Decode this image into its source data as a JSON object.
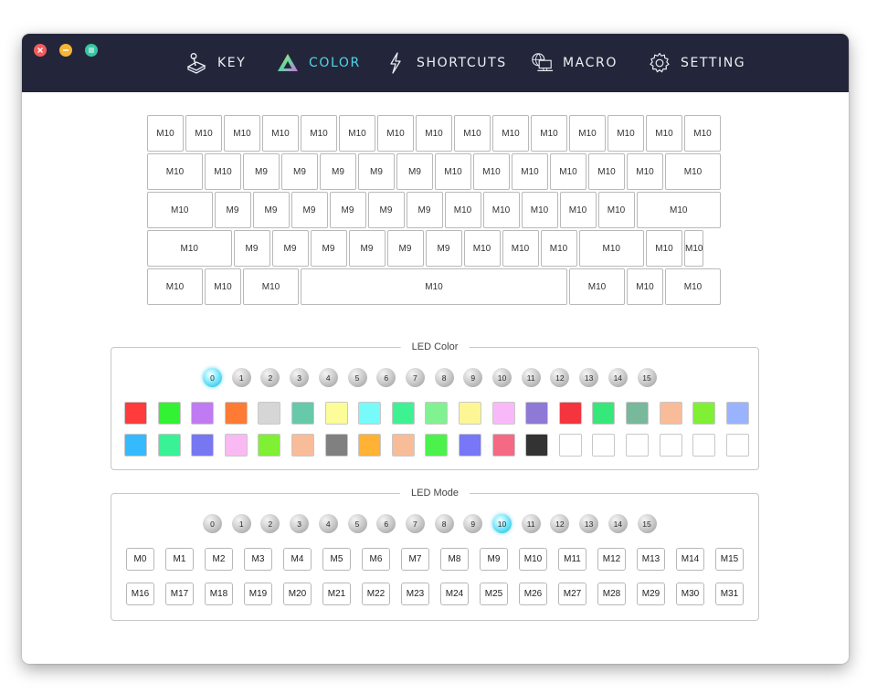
{
  "nav": [
    {
      "label": "KEY",
      "icon": "joystick-icon"
    },
    {
      "label": "COLOR",
      "icon": "triangle-gradient-icon",
      "active": true
    },
    {
      "label": "SHORTCUTS",
      "icon": "lightning-icon"
    },
    {
      "label": "MACRO",
      "icon": "computer-globe-icon"
    },
    {
      "label": "SETTING",
      "icon": "gear-icon"
    }
  ],
  "keyboard": {
    "rows": [
      [
        "M10",
        "M10",
        "M10",
        "M10",
        "M10",
        "M10",
        "M10",
        "M10",
        "M10",
        "M10",
        "M10",
        "M10",
        "M10",
        "M10",
        "M10"
      ],
      [
        "M10",
        "M10",
        "M9",
        "M9",
        "M9",
        "M9",
        "M9",
        "M10",
        "M10",
        "M10",
        "M10",
        "M10",
        "M10",
        "M10"
      ],
      [
        "M10",
        "M9",
        "M9",
        "M9",
        "M9",
        "M9",
        "M9",
        "M10",
        "M10",
        "M10",
        "M10",
        "M10",
        "M10"
      ],
      [
        "M10",
        "M9",
        "M9",
        "M9",
        "M9",
        "M9",
        "M9",
        "M10",
        "M10",
        "M10",
        "M10",
        "M10",
        "M10"
      ],
      [
        "M10",
        "M10",
        "M10",
        "M10",
        "M10",
        "M10",
        "M10"
      ]
    ]
  },
  "led_color": {
    "title": "LED Color",
    "selected_index": 0,
    "indices": [
      "0",
      "1",
      "2",
      "3",
      "4",
      "5",
      "6",
      "7",
      "8",
      "9",
      "10",
      "11",
      "12",
      "13",
      "14",
      "15"
    ],
    "swatch_rows": [
      [
        "#ff3b3b",
        "#33f233",
        "#c07bf2",
        "#ff7a33",
        "#d6d6d6",
        "#66c9a9",
        "#fcfc99",
        "#77fafa",
        "#3ff291",
        "#80f291",
        "#fcf794",
        "#f9b9f9",
        "#8f79d6",
        "#f4353d",
        "#36e87a",
        "#77b99a",
        "#f9bc99",
        "#7ff033",
        "#99b3ff"
      ],
      [
        "#36baff",
        "#38f295",
        "#7777f2",
        "#f9b9f2",
        "#7ff033",
        "#f9bc99",
        "#808080",
        "#ffb233",
        "#f9bc99",
        "#4cf24c",
        "#7777f7",
        "#f56985",
        "#333333",
        "#ffffff",
        "#ffffff",
        "#ffffff",
        "#ffffff",
        "#ffffff",
        "#ffffff"
      ]
    ]
  },
  "led_mode": {
    "title": "LED Mode",
    "selected_index": 10,
    "indices": [
      "0",
      "1",
      "2",
      "3",
      "4",
      "5",
      "6",
      "7",
      "8",
      "9",
      "10",
      "11",
      "12",
      "13",
      "14",
      "15"
    ],
    "mode_rows": [
      [
        "M0",
        "M1",
        "M2",
        "M3",
        "M4",
        "M5",
        "M6",
        "M7",
        "M8",
        "M9",
        "M10",
        "M11",
        "M12",
        "M13",
        "M14",
        "M15"
      ],
      [
        "M16",
        "M17",
        "M18",
        "M19",
        "M20",
        "M21",
        "M22",
        "M23",
        "M24",
        "M25",
        "M26",
        "M27",
        "M28",
        "M29",
        "M30",
        "M31"
      ]
    ]
  }
}
